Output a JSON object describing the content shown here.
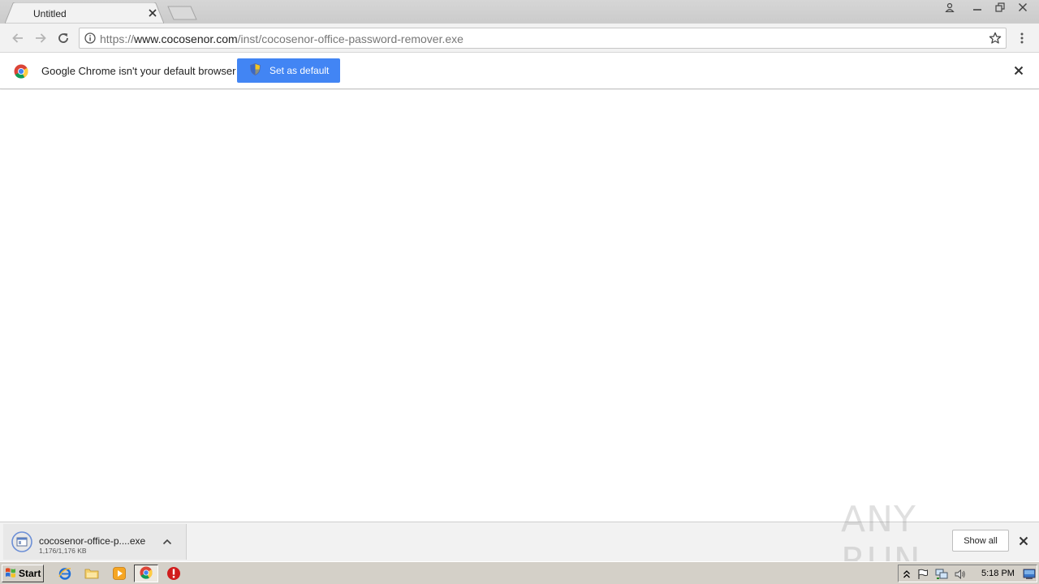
{
  "tab": {
    "title": "Untitled"
  },
  "toolbar": {
    "url_scheme": "https://",
    "url_host": "www.cocosenor.com",
    "url_path": "/inst/cocosenor-office-password-remover.exe"
  },
  "infobar": {
    "message": "Google Chrome isn't your default browser",
    "button_label": "Set as default"
  },
  "download_shelf": {
    "items": [
      {
        "filename": "cocosenor-office-p....exe",
        "progress": "1,176/1,176 KB"
      }
    ],
    "show_all_label": "Show all",
    "watermark": "ANY RUN"
  },
  "taskbar": {
    "start_label": "Start",
    "clock": "5:18 PM"
  },
  "colors": {
    "accent_button": "#4285f4",
    "tabstrip": "#cbcbcb",
    "taskbar": "#d4d0c8"
  },
  "icons": [
    "info-icon",
    "star-icon",
    "chrome-icon",
    "shield-icon",
    "close-icon",
    "back-icon",
    "forward-icon",
    "reload-icon",
    "menu-icon",
    "user-icon",
    "minimize-icon",
    "restore-icon",
    "file-icon",
    "chevron-up-icon",
    "ie-icon",
    "folder-icon",
    "media-player-icon",
    "stop-icon",
    "flag-icon",
    "network-icon",
    "volume-icon",
    "desktop-icon",
    "start-flag-icon"
  ]
}
